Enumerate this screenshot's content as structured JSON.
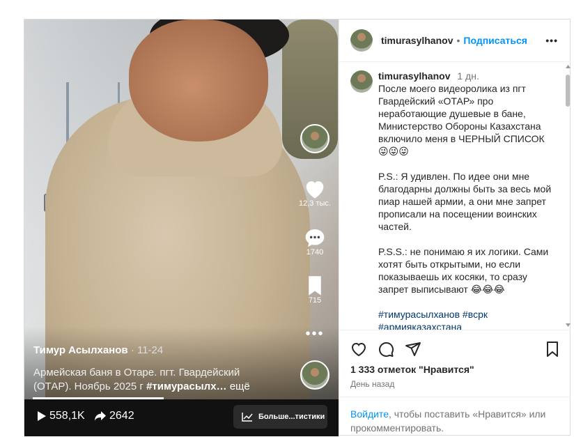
{
  "post": {
    "username": "timurasylhanov",
    "separator": "•",
    "follow_label": "Подписаться",
    "more_label": "•••"
  },
  "media": {
    "author": "Тимур Асылханов",
    "date": "· 11-24",
    "caption_line1": "Армейская баня в Отаре.  пгт. Гвардейский",
    "caption_line2_plain": "(ОТАР).  Ноябрь 2025 г ",
    "caption_line2_bold": "#тимурасылх…",
    "caption_more": " ещё",
    "likes": "12,3 тыс.",
    "comments": "1740",
    "saves": "715",
    "views": "558,1K",
    "shares": "2642",
    "stats_label": "Больше...тистики",
    "progress": 0.44
  },
  "comment": {
    "username": "timurasylhanov",
    "time": "1 дн.",
    "p1": "После моего видеоролика из пгт Гвардейский «ОТАР» про неработающие душевые в бане, Министерство Обороны Казахстана включило меня в ЧЕРНЫЙ СПИСОК 😜😜😜",
    "p2": "P.S.: Я удивлен. По идее они мне благодарны должны  быть за весь мой пиар нашей армии, а они мне запрет прописали на посещении воинских частей.",
    "p3": "P.S.S.: не понимаю я их логики. Сами хотят быть открытыми, но если показываешь их косяки, то сразу запрет выписывают 😂😂😂",
    "tags1": "#тимурасылханов #вcрк",
    "tags2": "#армияказахстана"
  },
  "actions": {
    "likes_text": "1 333 отметок \"Нравится\"",
    "posted_ago": "День назад"
  },
  "footer": {
    "login_link": "Войдите",
    "login_rest": ", чтобы поставить «Нравится» или прокомментировать."
  }
}
